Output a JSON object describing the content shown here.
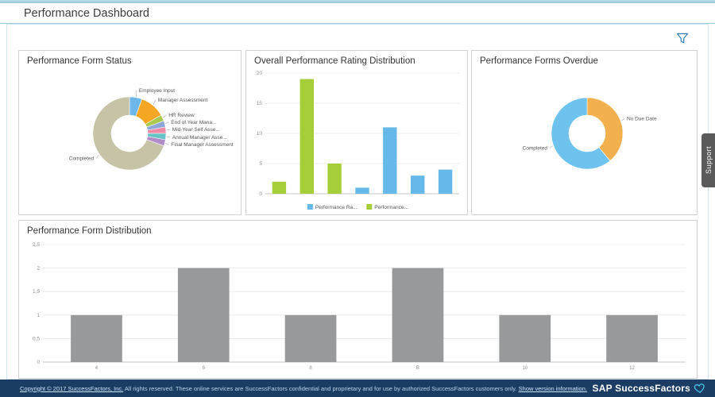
{
  "header": {
    "title": "Performance Dashboard"
  },
  "support_tab": {
    "label": "Support"
  },
  "panels": {
    "form_status": {
      "title": "Performance Form Status"
    },
    "rating_distribution": {
      "title": "Overall Performance Rating Distribution"
    },
    "forms_overdue": {
      "title": "Performance Forms Overdue"
    },
    "form_distribution": {
      "title": "Performance Form Distribution"
    }
  },
  "footer": {
    "copyright_link": "Copyright © 2017 SuccessFactors, Inc.",
    "copyright_text": "All rights reserved. These online services are SuccessFactors confidential and proprietary and for use by authorized SuccessFactors customers only.",
    "version_link": "Show version information.",
    "brand": "SAP SuccessFactors",
    "bar_color": "#1b3c63",
    "heart_color": "#43c5ea"
  },
  "chart_data": [
    {
      "id": "form-status-donut",
      "type": "pie",
      "donut": true,
      "title": "Performance Form Status",
      "segments": [
        {
          "label": "Employee Input",
          "value": 2,
          "color": "#6db8e8"
        },
        {
          "label": "Manager Assessment",
          "value": 4,
          "color": "#f5a623"
        },
        {
          "label": "HR Review",
          "value": 1,
          "color": "#a8c94e"
        },
        {
          "label": "End of Year Mana...",
          "value": 1,
          "color": "#8fa6d8"
        },
        {
          "label": "Mid-Year Self Asse...",
          "value": 1,
          "color": "#ef8aa4"
        },
        {
          "label": "Annual Manager Asse...",
          "value": 1,
          "color": "#67c3c6"
        },
        {
          "label": "Final Manager Assessment",
          "value": 1,
          "color": "#b08cc9"
        },
        {
          "label": "Completed",
          "value": 25,
          "color": "#c7c3a6"
        }
      ]
    },
    {
      "id": "rating-distribution-bars",
      "type": "bar",
      "title": "Overall Performance Rating Distribution",
      "ymax": 20,
      "yticks": [
        0,
        5,
        10,
        15,
        20
      ],
      "grid": true,
      "bars": [
        {
          "value": 2,
          "color": "#a5ce39"
        },
        {
          "value": 19,
          "color": "#a5ce39"
        },
        {
          "value": 5,
          "color": "#a5ce39"
        },
        {
          "value": 1,
          "color": "#64b9e9"
        },
        {
          "value": 11,
          "color": "#64b9e9"
        },
        {
          "value": 3,
          "color": "#64b9e9"
        },
        {
          "value": 4,
          "color": "#64b9e9"
        }
      ],
      "legend": [
        {
          "label": "Performance Ra...",
          "color": "#64b9e9"
        },
        {
          "label": "Performance...",
          "color": "#a5ce39"
        }
      ]
    },
    {
      "id": "forms-overdue-donut",
      "type": "pie",
      "donut": true,
      "title": "Performance Forms Overdue",
      "segments": [
        {
          "label": "No Due Date",
          "value": 14,
          "color": "#f2b04e"
        },
        {
          "label": "Completed",
          "value": 22,
          "color": "#6ec2ee"
        }
      ]
    },
    {
      "id": "form-distribution-bars",
      "type": "bar",
      "title": "Performance Form Distribution",
      "ymax": 2.5,
      "yticks": [
        0,
        0.5,
        1,
        1.5,
        2,
        2.5
      ],
      "grid": true,
      "bar_color": "#97999b",
      "bars": [
        {
          "value": 1,
          "label": "4"
        },
        {
          "value": 2,
          "label": "6"
        },
        {
          "value": 1,
          "label": "8"
        },
        {
          "value": 2,
          "label": "B"
        },
        {
          "value": 1,
          "label": "10"
        },
        {
          "value": 1,
          "label": "12"
        }
      ]
    }
  ]
}
